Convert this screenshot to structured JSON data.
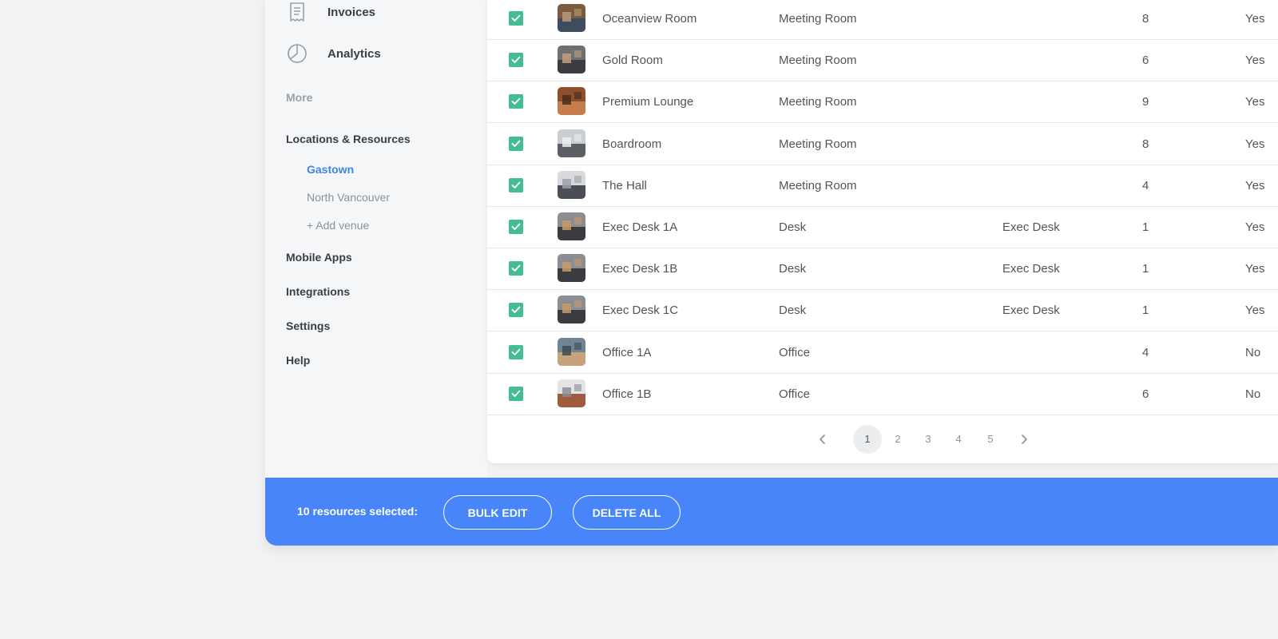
{
  "sidebar": {
    "nav": [
      {
        "label": "Invoices",
        "icon": "receipt-icon"
      },
      {
        "label": "Analytics",
        "icon": "pie-chart-icon"
      }
    ],
    "more_label": "More",
    "locations_label": "Locations & Resources",
    "venues": [
      {
        "label": "Gastown",
        "active": true
      },
      {
        "label": "North Vancouver",
        "active": false
      }
    ],
    "add_venue_label": "+ Add venue",
    "links": [
      "Mobile Apps",
      "Integrations",
      "Settings",
      "Help"
    ]
  },
  "table": {
    "rows": [
      {
        "name": "Oceanview Room",
        "type": "Meeting Room",
        "category": "",
        "capacity": "8",
        "active": "Yes",
        "thumb": [
          "#7b5a3f",
          "#3e4c5e",
          "#b89a7a"
        ]
      },
      {
        "name": "Gold Room",
        "type": "Meeting Room",
        "category": "",
        "capacity": "6",
        "active": "Yes",
        "thumb": [
          "#6d6f73",
          "#3b3d42",
          "#c2a07c"
        ]
      },
      {
        "name": "Premium Lounge",
        "type": "Meeting Room",
        "category": "",
        "capacity": "9",
        "active": "Yes",
        "thumb": [
          "#8d4f2e",
          "#c77d4b",
          "#4a2b1c"
        ]
      },
      {
        "name": "Boardroom",
        "type": "Meeting Room",
        "category": "",
        "capacity": "8",
        "active": "Yes",
        "thumb": [
          "#c9cdd2",
          "#5b5f66",
          "#eceef0"
        ]
      },
      {
        "name": "The Hall",
        "type": "Meeting Room",
        "category": "",
        "capacity": "4",
        "active": "Yes",
        "thumb": [
          "#d7d9dc",
          "#4b4f55",
          "#9aa0a6"
        ]
      },
      {
        "name": "Exec Desk 1A",
        "type": "Desk",
        "category": "Exec Desk",
        "capacity": "1",
        "active": "Yes",
        "thumb": [
          "#8a8d92",
          "#3a3c40",
          "#c89a6b"
        ]
      },
      {
        "name": "Exec Desk 1B",
        "type": "Desk",
        "category": "Exec Desk",
        "capacity": "1",
        "active": "Yes",
        "thumb": [
          "#8a8d92",
          "#3a3c40",
          "#c89a6b"
        ]
      },
      {
        "name": "Exec Desk 1C",
        "type": "Desk",
        "category": "Exec Desk",
        "capacity": "1",
        "active": "Yes",
        "thumb": [
          "#8a8d92",
          "#3a3c40",
          "#c89a6b"
        ]
      },
      {
        "name": "Office 1A",
        "type": "Office",
        "category": "",
        "capacity": "4",
        "active": "No",
        "thumb": [
          "#6f8596",
          "#c6a37c",
          "#3f4a52"
        ]
      },
      {
        "name": "Office 1B",
        "type": "Office",
        "category": "",
        "capacity": "6",
        "active": "No",
        "thumb": [
          "#e3e4e6",
          "#a05a3c",
          "#8a8e93"
        ]
      }
    ]
  },
  "pagination": {
    "pages": [
      "1",
      "2",
      "3",
      "4",
      "5"
    ],
    "current": "1"
  },
  "bulk_bar": {
    "text": "10 resources selected:",
    "bulk_edit_label": "BULK EDIT",
    "delete_all_label": "DELETE ALL"
  },
  "colors": {
    "accent": "#4785f9",
    "checkbox": "#45bd93",
    "active_link": "#3f86e8"
  }
}
